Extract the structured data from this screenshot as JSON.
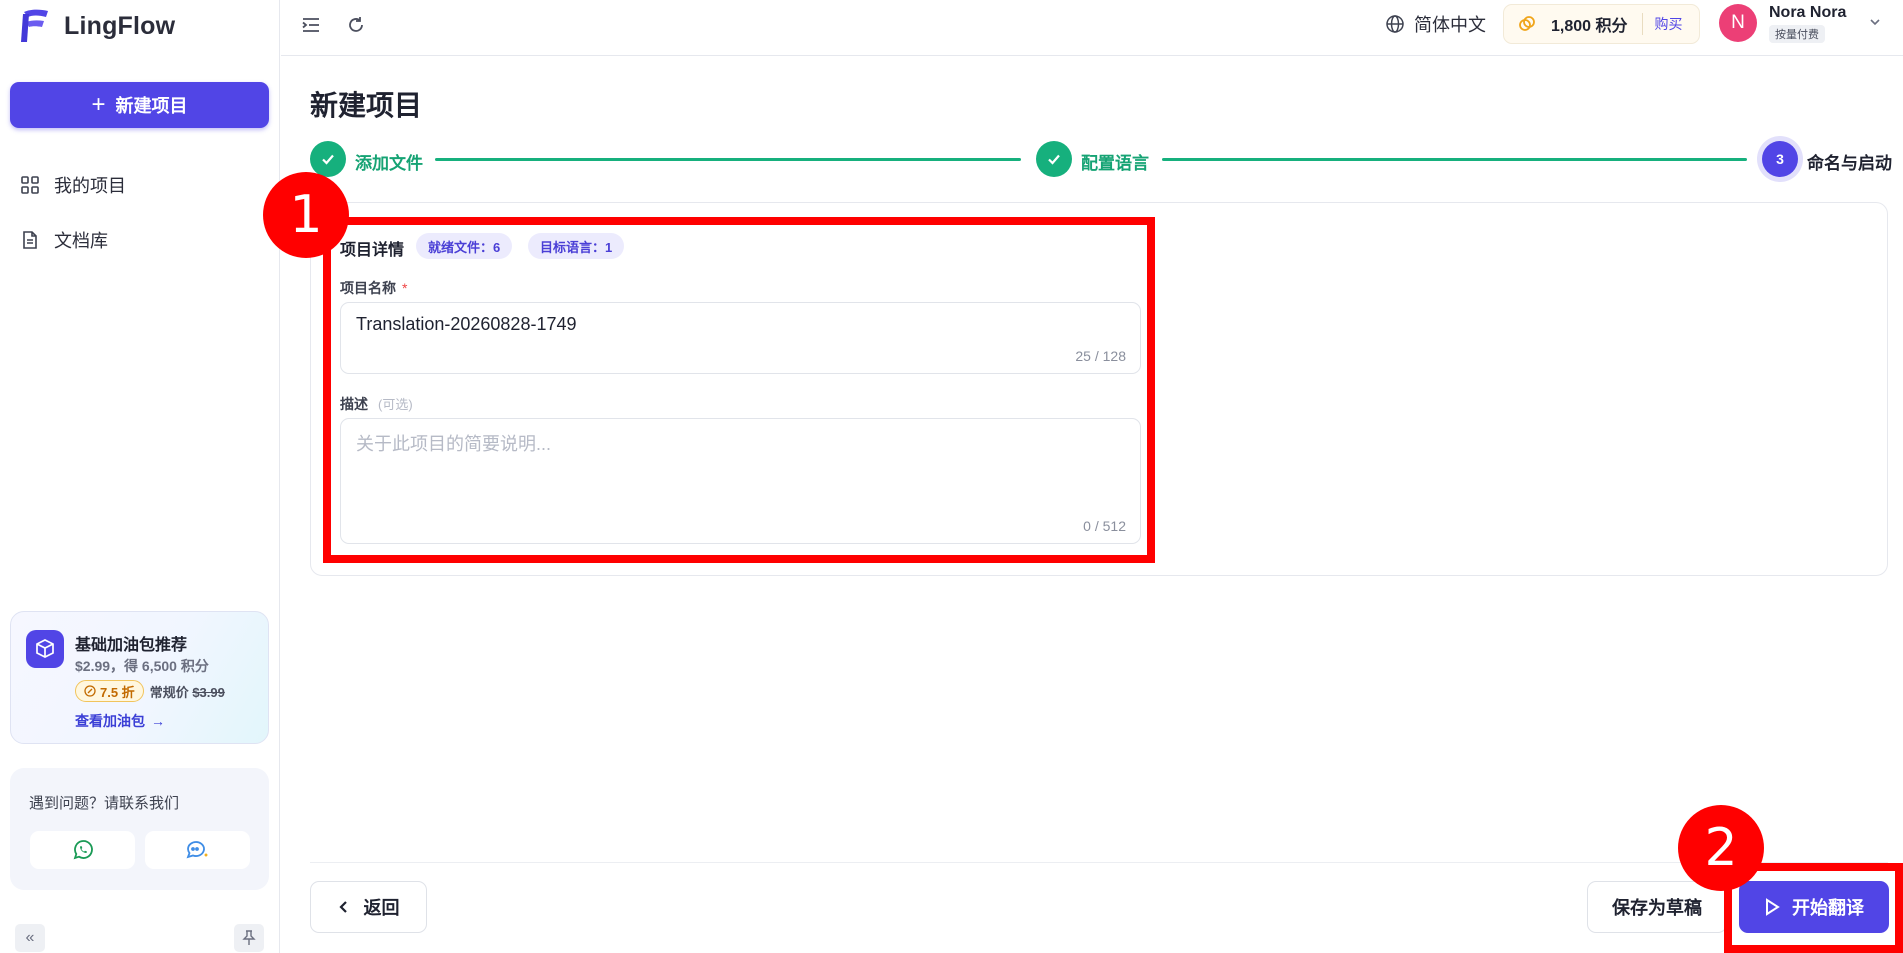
{
  "app": {
    "name": "LingFlow"
  },
  "sidebar": {
    "new_project_label": "新建项目",
    "nav": [
      {
        "label": "我的项目",
        "icon": "grid-icon"
      },
      {
        "label": "文档库",
        "icon": "document-icon"
      }
    ],
    "promo": {
      "title": "基础加油包推荐",
      "price": "$2.99，得 6,500 积分",
      "discount": "7.5 折",
      "regular_label": "常规价",
      "regular_price": "$3.99",
      "link": "查看加油包"
    },
    "help": {
      "text": "遇到问题？请联系我们"
    }
  },
  "topbar": {
    "language": "简体中文",
    "credits": "1,800 积分",
    "buy": "购买",
    "user": {
      "initial": "N",
      "name": "Nora Nora",
      "plan": "按量付费"
    }
  },
  "main": {
    "title": "新建项目",
    "steps": [
      {
        "label": "添加文件",
        "status": "done"
      },
      {
        "label": "配置语言",
        "status": "done"
      },
      {
        "number": "3",
        "label": "命名与启动",
        "status": "active"
      }
    ],
    "details": {
      "title": "项目详情",
      "chip_files": "就绪文件：6",
      "chip_langs": "目标语言：1",
      "name_label": "项目名称",
      "name_required": "*",
      "name_value": "Translation-20260828-1749",
      "name_count": "25 / 128",
      "desc_label": "描述",
      "desc_optional": "(可选)",
      "desc_placeholder": "关于此项目的简要说明...",
      "desc_count": "0 / 512"
    },
    "actions": {
      "back": "返回",
      "save_draft": "保存为草稿",
      "start": "开始翻译"
    }
  },
  "annotations": [
    {
      "label": "1"
    },
    {
      "label": "2"
    }
  ],
  "colors": {
    "primary": "#5145e6",
    "success": "#16b07d",
    "annotation": "#ff0000"
  }
}
